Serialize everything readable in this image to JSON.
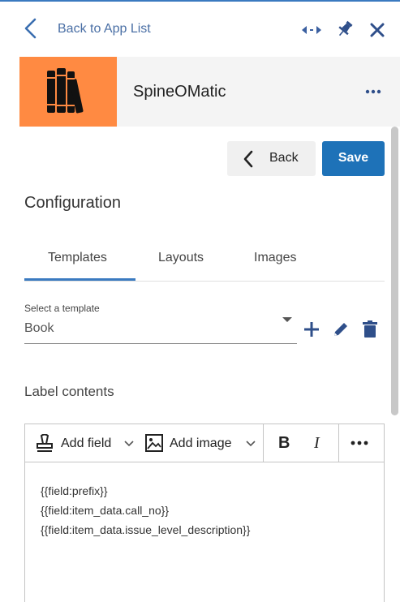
{
  "nav": {
    "back_label": "Back to App List"
  },
  "app": {
    "name": "SpineOMatic",
    "logo_color": "#ff8a42"
  },
  "actions": {
    "back_label": "Back",
    "save_label": "Save"
  },
  "config": {
    "title": "Configuration",
    "tabs": [
      {
        "label": "Templates",
        "active": true
      },
      {
        "label": "Layouts",
        "active": false
      },
      {
        "label": "Images",
        "active": false
      }
    ],
    "template_select": {
      "label": "Select a template",
      "value": "Book"
    },
    "label_contents_title": "Label contents"
  },
  "editor": {
    "toolbar": {
      "add_field": "Add field",
      "add_image": "Add image",
      "bold": "B",
      "italic": "I"
    },
    "lines": [
      "{{field:prefix}}",
      "{{field:item_data.call_no}}",
      "{{field:item_data.issue_level_description}}"
    ]
  },
  "colors": {
    "accent": "#3a7ac0",
    "primary_button": "#1e72b8",
    "link": "#4a6fa5"
  }
}
